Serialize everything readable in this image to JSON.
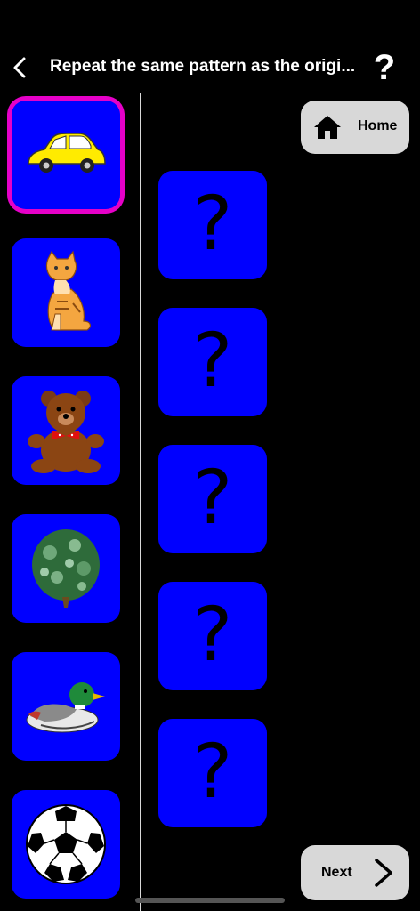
{
  "header": {
    "title": "Repeat the same pattern as the origi...",
    "back_icon": "chevron-left-icon",
    "help_icon": "question-mark-icon"
  },
  "tiles": [
    {
      "name": "car",
      "icon": "car-icon",
      "selected": true
    },
    {
      "name": "cat",
      "icon": "cat-icon",
      "selected": false
    },
    {
      "name": "teddy-bear",
      "icon": "teddy-bear-icon",
      "selected": false
    },
    {
      "name": "tree",
      "icon": "tree-icon",
      "selected": false
    },
    {
      "name": "duck",
      "icon": "duck-icon",
      "selected": false
    },
    {
      "name": "soccer-ball",
      "icon": "soccer-ball-icon",
      "selected": false
    }
  ],
  "slots": [
    {
      "label": "?"
    },
    {
      "label": "?"
    },
    {
      "label": "?"
    },
    {
      "label": "?"
    },
    {
      "label": "?"
    }
  ],
  "buttons": {
    "home_label": "Home",
    "next_label": "Next"
  },
  "colors": {
    "background": "#000000",
    "tile": "#0000ff",
    "selected_border": "#e600c8",
    "button": "#d8d8d8"
  }
}
